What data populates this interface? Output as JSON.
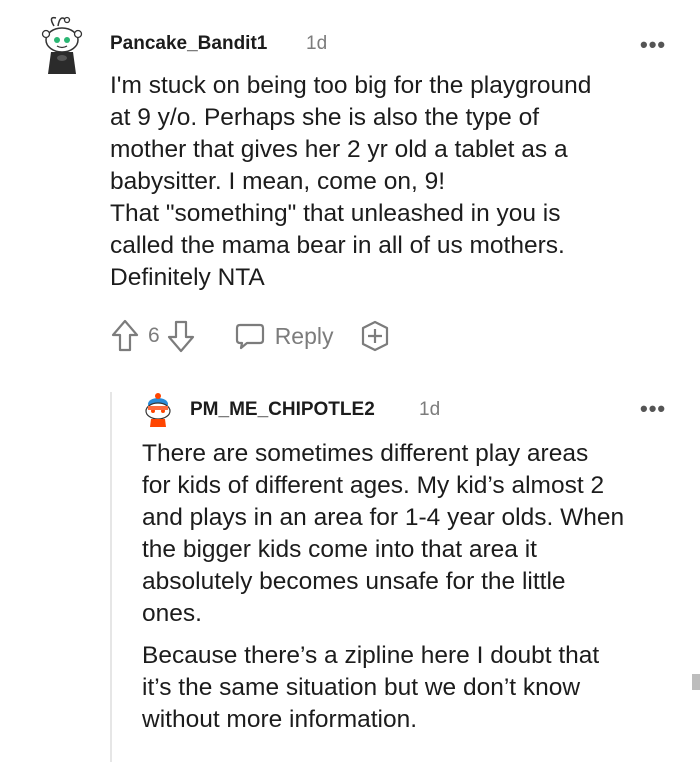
{
  "comment": {
    "username": "Pancake_Bandit1",
    "time": "1d",
    "lines": [
      "I'm stuck on being too big for the playground",
      "at 9 y/o. Perhaps she is also the type of",
      "mother that gives her 2 yr old a tablet as a",
      "babysitter. I mean, come on, 9!",
      "That \"something\" that unleashed in you is",
      "called the mama bear in all of us mothers.",
      "Definitely NTA"
    ],
    "votes": "6",
    "reply_label": "Reply"
  },
  "reply": {
    "username": "PM_ME_CHIPOTLE2",
    "time": "1d",
    "paragraph1": [
      "There are sometimes different play areas",
      "for kids of different ages. My kid’s almost 2",
      "and plays in an area for 1-4 year olds. When",
      "the bigger kids come into that area it",
      "absolutely becomes unsafe for the little",
      "ones."
    ],
    "paragraph2": [
      "Because there’s a zipline here I doubt that",
      "it’s the same situation but we don’t know",
      "without more information."
    ]
  },
  "icons": {
    "more": "more-options-icon",
    "upvote": "upvote-arrow-icon",
    "downvote": "downvote-arrow-icon",
    "reply": "speech-bubble-icon",
    "award": "plus-circle-icon"
  }
}
